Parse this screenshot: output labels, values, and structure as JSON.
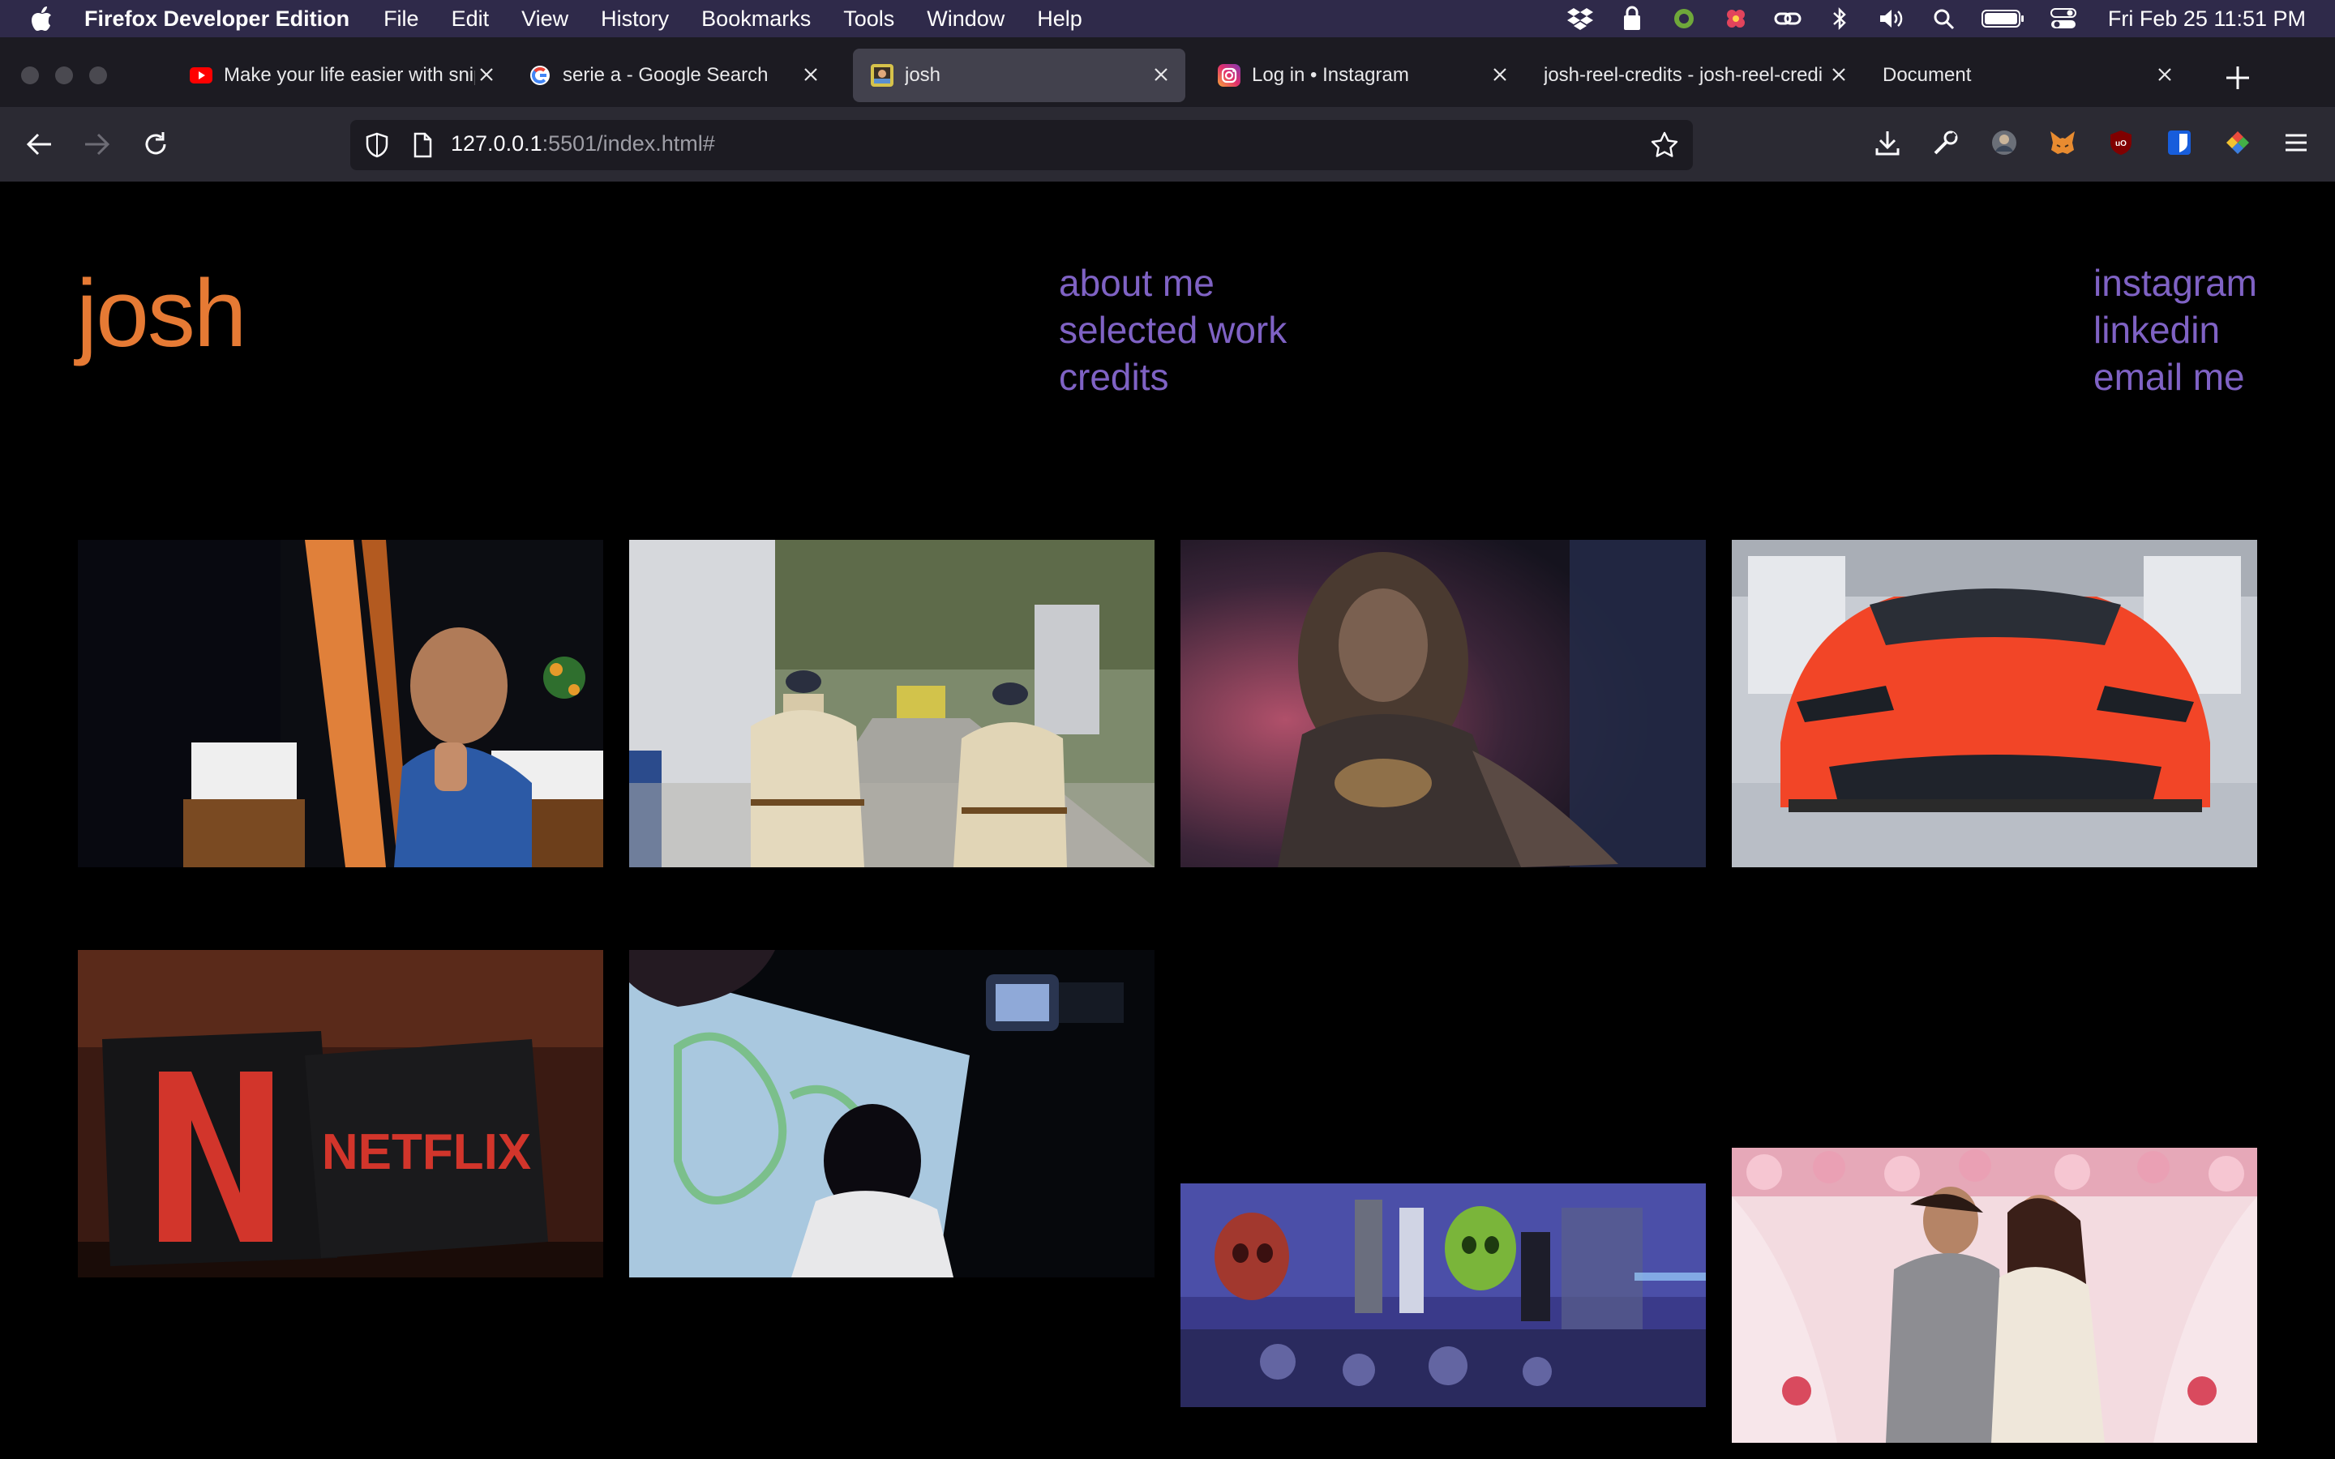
{
  "menubar": {
    "app_name": "Firefox Developer Edition",
    "items": [
      "File",
      "Edit",
      "View",
      "History",
      "Bookmarks",
      "Tools",
      "Window",
      "Help"
    ],
    "clock": "Fri Feb 25  11:51 PM",
    "status_icons": [
      "dropbox-icon",
      "lock-icon",
      "app-icon",
      "flower-icon",
      "link-icon",
      "bluetooth-icon",
      "volume-icon",
      "search-icon",
      "battery-icon",
      "control-center-icon"
    ]
  },
  "tabs": [
    {
      "title": "Make your life easier with snippets",
      "favicon": "youtube-icon"
    },
    {
      "title": "serie a - Google Search",
      "favicon": "google-icon"
    },
    {
      "title": "josh",
      "favicon": "site-icon",
      "active": true
    },
    {
      "title": "Log in • Instagram",
      "favicon": "instagram-icon"
    },
    {
      "title": "josh-reel-credits - josh-reel-credits",
      "favicon": ""
    },
    {
      "title": "Document",
      "favicon": ""
    }
  ],
  "urlbar": {
    "host": "127.0.0.1",
    "rest": ":5501/index.html#"
  },
  "site": {
    "logo": "josh",
    "nav": [
      "about me",
      "selected work",
      "credits"
    ],
    "social": [
      "instagram",
      "linkedin",
      "email me"
    ],
    "colors": {
      "logo": "#e67a34",
      "links": "#7f62c4",
      "background": "#000000"
    }
  },
  "gallery": [
    {
      "id": "thumb-man-thumbs-up"
    },
    {
      "id": "thumb-police-street"
    },
    {
      "id": "thumb-bearded-figure"
    },
    {
      "id": "thumb-orange-sports-car"
    },
    {
      "id": "thumb-netflix-pillows"
    },
    {
      "id": "thumb-projection-art"
    },
    {
      "id": "thumb-skull-bottles"
    },
    {
      "id": "thumb-couple-flowers"
    }
  ]
}
